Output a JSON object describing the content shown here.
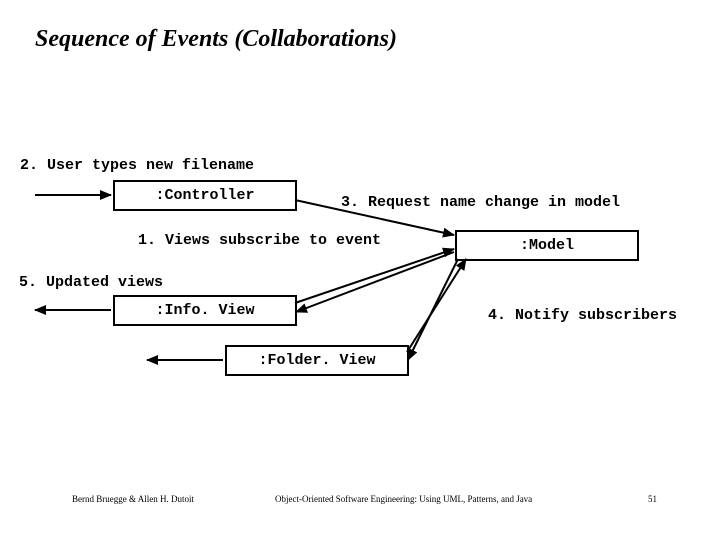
{
  "title": "Sequence of Events (Collaborations)",
  "boxes": {
    "controller": ":Controller",
    "model": ":Model",
    "infoview": ":Info. View",
    "folderview": ":Folder. View"
  },
  "labels": {
    "step1": "1. Views subscribe to event",
    "step2": "2. User types new filename",
    "step3": "3. Request name change in model",
    "step4": "4. Notify subscribers",
    "step5": "5. Updated views"
  },
  "footer": {
    "left": "Bernd Bruegge & Allen H. Dutoit",
    "center": "Object-Oriented Software Engineering: Using UML, Patterns, and Java",
    "right": "51"
  }
}
